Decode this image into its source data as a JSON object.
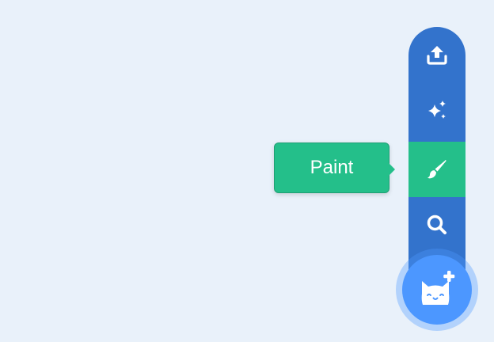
{
  "sprite_menu": {
    "items": [
      {
        "name": "upload",
        "icon": "upload-icon"
      },
      {
        "name": "surprise",
        "icon": "sparkle-icon"
      },
      {
        "name": "paint",
        "icon": "paintbrush-icon",
        "active": true
      },
      {
        "name": "search",
        "icon": "search-icon"
      }
    ],
    "main_button": {
      "icon": "cat-plus-icon"
    },
    "colors": {
      "menu": "#3373cc",
      "active": "#24bf8a",
      "main_button": "#4c97ff",
      "background": "#e9f1fa"
    }
  },
  "tooltip": {
    "label": "Paint"
  }
}
